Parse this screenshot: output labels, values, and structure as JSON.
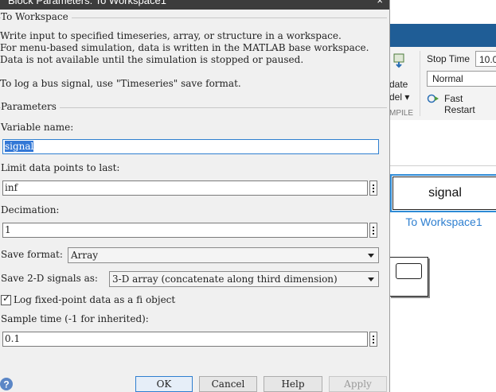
{
  "dialog": {
    "title": "Block Parameters: To Workspace1",
    "close_symbol": "×",
    "block_type": "To Workspace",
    "description": [
      "Write input to specified timeseries, array, or structure in a workspace.",
      "For menu-based simulation, data is written in the MATLAB base workspace.",
      "Data is not available until the simulation is stopped or paused."
    ],
    "bus_note": "To log a bus signal, use \"Timeseries\" save format.",
    "parameters_title": "Parameters",
    "variable_name": {
      "label": "Variable name:",
      "value": "signal"
    },
    "limit_data_points": {
      "label": "Limit data points to last:",
      "value": "inf"
    },
    "decimation": {
      "label": "Decimation:",
      "value": "1"
    },
    "save_format": {
      "label": "Save format:",
      "value": "Array"
    },
    "save_2d": {
      "label": "Save 2-D signals as:",
      "value": "3-D array (concatenate along third dimension)"
    },
    "log_fixed_point": {
      "label": "Log fixed-point data as a fi object",
      "checked": true,
      "check_symbol": "✓"
    },
    "sample_time": {
      "label": "Sample time (-1 for inherited):",
      "value": "0.1"
    },
    "buttons": {
      "ok": "OK",
      "cancel": "Cancel",
      "help": "Help",
      "apply": "Apply"
    },
    "help_icon_symbol": "?"
  },
  "background": {
    "ribbon": {
      "update_label_1": "date",
      "update_label_2": "del ▾",
      "compile_label": "MPILE",
      "stop_time_label": "Stop Time",
      "stop_time_value": "10.0",
      "sim_mode": "Normal",
      "fast_restart": "Fast Restart"
    },
    "block": {
      "text": "signal",
      "name": "To Workspace1"
    }
  },
  "colors": {
    "accent": "#2f7fd0",
    "selection": "#3378d6",
    "ribbon_blue": "#1f5d96",
    "block_name": "#2e7fd0",
    "dialog_bg": "#f0f0f0"
  }
}
